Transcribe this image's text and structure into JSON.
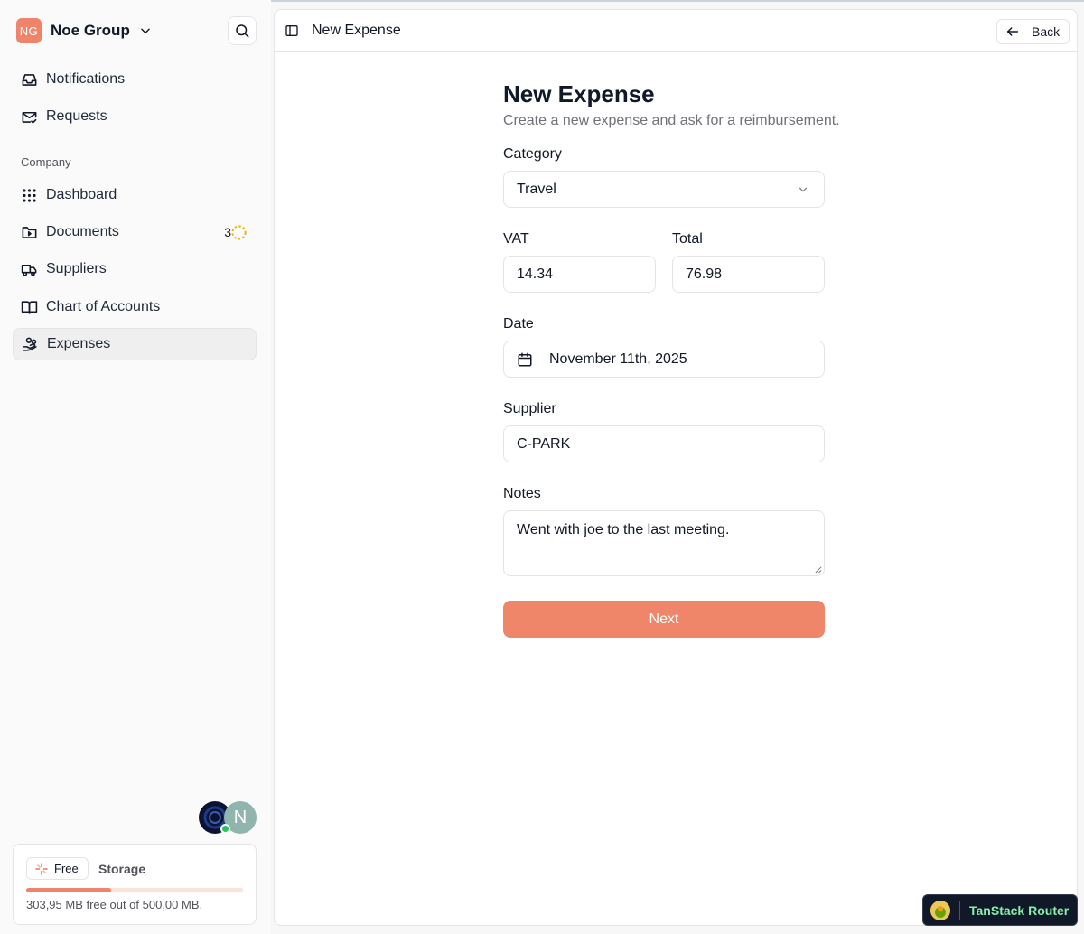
{
  "sidebar": {
    "org": {
      "initials": "NG",
      "name": "Noe Group"
    },
    "primary_items": [
      {
        "label": "Notifications",
        "icon": "inbox-icon"
      },
      {
        "label": "Requests",
        "icon": "mail-check-icon"
      }
    ],
    "section_label": "Company",
    "company_items": [
      {
        "label": "Dashboard",
        "icon": "grid-dots-icon"
      },
      {
        "label": "Documents",
        "icon": "folder-icon",
        "badge": "3"
      },
      {
        "label": "Suppliers",
        "icon": "truck-icon"
      },
      {
        "label": "Chart of Accounts",
        "icon": "book-open-icon"
      },
      {
        "label": "Expenses",
        "icon": "hand-coins-icon",
        "active": true
      }
    ],
    "avatar_initial": "N",
    "storage": {
      "plan": "Free",
      "label": "Storage",
      "usage_text": "303,95 MB free out of 500,00 MB.",
      "used_fraction": 0.39
    }
  },
  "header": {
    "title": "New Expense",
    "back_label": "Back"
  },
  "form": {
    "title": "New Expense",
    "subtitle": "Create a new expense and ask for a reimbursement.",
    "category": {
      "label": "Category",
      "value": "Travel"
    },
    "vat": {
      "label": "VAT",
      "value": "14.34"
    },
    "total": {
      "label": "Total",
      "value": "76.98"
    },
    "date": {
      "label": "Date",
      "value": "November 11th, 2025"
    },
    "supplier": {
      "label": "Supplier",
      "value": "C-PARK"
    },
    "notes": {
      "label": "Notes",
      "value": "Went with joe to the last meeting."
    },
    "next_label": "Next"
  },
  "devtools": {
    "label": "TanStack Router"
  },
  "colors": {
    "accent": "#ef8569",
    "org_badge": "#f0846b",
    "online": "#22c55e",
    "devtools_text": "#86efac"
  }
}
